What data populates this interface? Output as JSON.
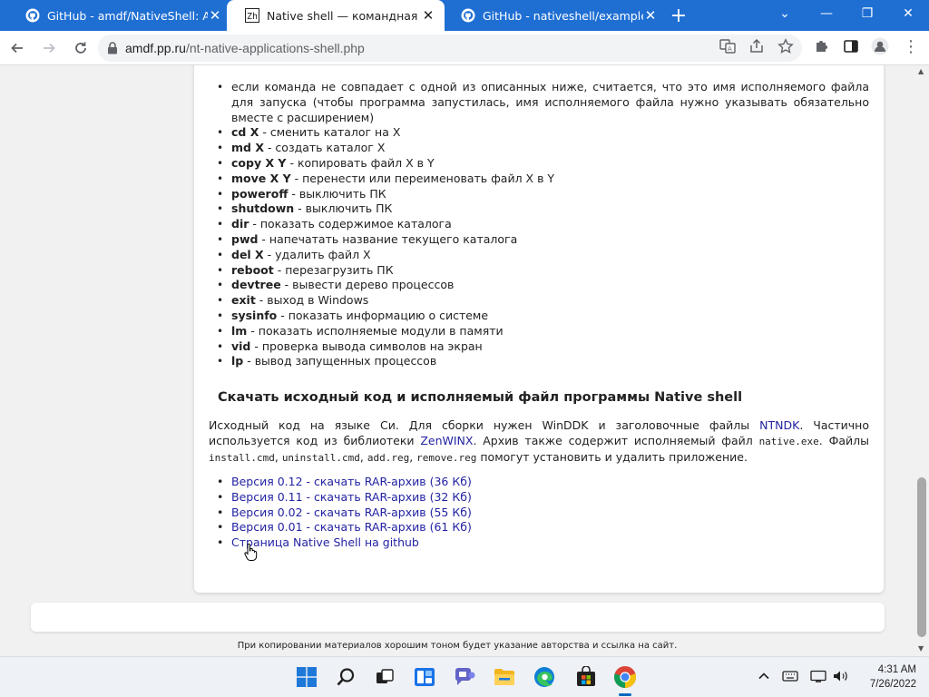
{
  "browser": {
    "tabs": [
      {
        "title": "GitHub - amdf/NativeShell: A she",
        "icon": "github-icon",
        "active": false
      },
      {
        "title": "Native shell — командная строк",
        "icon": "site-favicon",
        "active": true
      },
      {
        "title": "GitHub - nativeshell/examples",
        "icon": "github-icon",
        "active": false
      }
    ],
    "new_tab": "+",
    "url_host": "amdf.pp.ru",
    "url_path": "/nt-native-applications-shell.php"
  },
  "page": {
    "intro_item": "если команда не совпадает с одной из описанных ниже, считается, что это имя исполняемого файла для запуска (чтобы программа запустилась, имя исполняемого файла нужно указывать обязательно вместе с расширением)",
    "commands": [
      {
        "cmd": "cd X",
        "desc": " - сменить каталог на X"
      },
      {
        "cmd": "md X",
        "desc": " - создать каталог X"
      },
      {
        "cmd": "copy X Y",
        "desc": " - копировать файл X в Y"
      },
      {
        "cmd": "move X Y",
        "desc": " - перенести или переименовать файл X в Y"
      },
      {
        "cmd": "poweroff",
        "desc": " - выключить ПК"
      },
      {
        "cmd": "shutdown",
        "desc": " - выключить ПК"
      },
      {
        "cmd": "dir",
        "desc": " - показать содержимое каталога"
      },
      {
        "cmd": "pwd",
        "desc": " - напечатать название текущего каталога"
      },
      {
        "cmd": "del X",
        "desc": " - удалить файл X"
      },
      {
        "cmd": "reboot",
        "desc": " - перезагрузить ПК"
      },
      {
        "cmd": "devtree",
        "desc": " - вывести дерево процессов"
      },
      {
        "cmd": "exit",
        "desc": " - выход в Windows"
      },
      {
        "cmd": "sysinfo",
        "desc": " - показать информацию о системе"
      },
      {
        "cmd": "lm",
        "desc": " - показать исполняемые модули в памяти"
      },
      {
        "cmd": "vid",
        "desc": " - проверка вывода символов на экран"
      },
      {
        "cmd": "lp",
        "desc": " - вывод запущенных процессов"
      }
    ],
    "section_title": "Скачать исходный код и исполняемый файл программы Native shell",
    "desc": {
      "p1": "Исходный код на языке Си. Для сборки нужен WinDDK и заголовочные файлы ",
      "link1": "NTNDK",
      "p2": ". Частично используется код из библиотеки ",
      "link2": "ZenWINX",
      "p3": ". Архив также содержит исполняемый файл ",
      "file1": "native.exe",
      "p4": ". Файлы ",
      "file2": "install.cmd",
      "p5": ", ",
      "file3": "uninstall.cmd",
      "p6": ", ",
      "file4": "add.reg",
      "p7": ", ",
      "file5": "remove.reg",
      "p8": " помогут установить и удалить приложение."
    },
    "downloads": [
      "Версия 0.12 - скачать RAR-архив (36 Кб)",
      "Версия 0.11 - скачать RAR-архив (32 Кб)",
      "Версия 0.02 - скачать RAR-архив (55 Кб)",
      "Версия 0.01 - скачать RAR-архив (61 Кб)",
      "Страница Native Shell на github"
    ],
    "footer_text": "При копировании материалов хорошим тоном будет указание авторства и ссылка на сайт."
  },
  "taskbar": {
    "time": "4:31 AM",
    "date": "7/26/2022"
  },
  "colors": {
    "tabstrip": "#1f6fd3",
    "link": "#2323a3",
    "taskbar": "#eef1f6"
  }
}
